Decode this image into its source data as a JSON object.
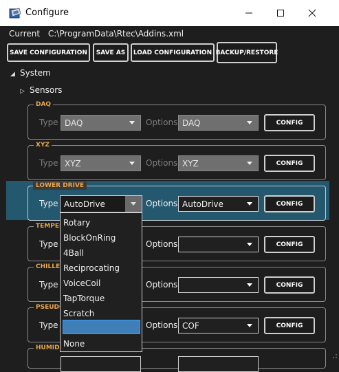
{
  "window": {
    "title": "Configure",
    "minimize_icon": "minimize-icon",
    "maximize_icon": "maximize-icon",
    "close_icon": "close-icon"
  },
  "current": {
    "label": "Current",
    "path": "C:\\ProgramData\\Rtec\\Addins.xml"
  },
  "toolbar": {
    "save_config": "SAVE CONFIGURATION",
    "save_as": "SAVE AS",
    "load_config": "LOAD CONFIGURATION",
    "backup_restore": "BACKUP/RESTORE"
  },
  "tree": {
    "system": "System",
    "sensors": "Sensors"
  },
  "groups": [
    {
      "label": "DAQ",
      "type_label": "Type",
      "type_value": "DAQ",
      "options_label": "Options",
      "options_value": "DAQ",
      "config": "CONFIG",
      "enabled": false
    },
    {
      "label": "XYZ",
      "type_label": "Type",
      "type_value": "XYZ",
      "options_label": "Options",
      "options_value": "XYZ",
      "config": "CONFIG",
      "enabled": false
    },
    {
      "label": "LOWER DRIVE",
      "type_label": "Type",
      "type_value": "AutoDrive",
      "options_label": "Options",
      "options_value": "AutoDrive",
      "config": "CONFIG",
      "enabled": true
    },
    {
      "label": "TEMPER",
      "type_label": "Type",
      "type_value": "",
      "options_label": "Options",
      "options_value": "",
      "config": "CONFIG",
      "enabled": true
    },
    {
      "label": "CHILLER",
      "type_label": "Type",
      "type_value": "",
      "options_label": "Options",
      "options_value": "",
      "config": "CONFIG",
      "enabled": true
    },
    {
      "label": "PSEUDO",
      "type_label": "Type",
      "type_value": "",
      "options_label": "Options",
      "options_value": "COF",
      "config": "CONFIG",
      "enabled": true
    },
    {
      "label": "HUMIDI",
      "type_label": "",
      "type_value": "",
      "options_label": "",
      "options_value": "",
      "config": "",
      "enabled": true
    }
  ],
  "dropdown": {
    "options": [
      "Rotary",
      "BlockOnRing",
      "4Ball",
      "Reciprocating",
      "VoiceCoil",
      "TapTorque",
      "Scratch",
      "",
      "None"
    ],
    "selected_index": 7
  },
  "colors": {
    "group_label": "#e7a64a",
    "highlight": "#24586f",
    "selection": "#3d7fb6"
  }
}
